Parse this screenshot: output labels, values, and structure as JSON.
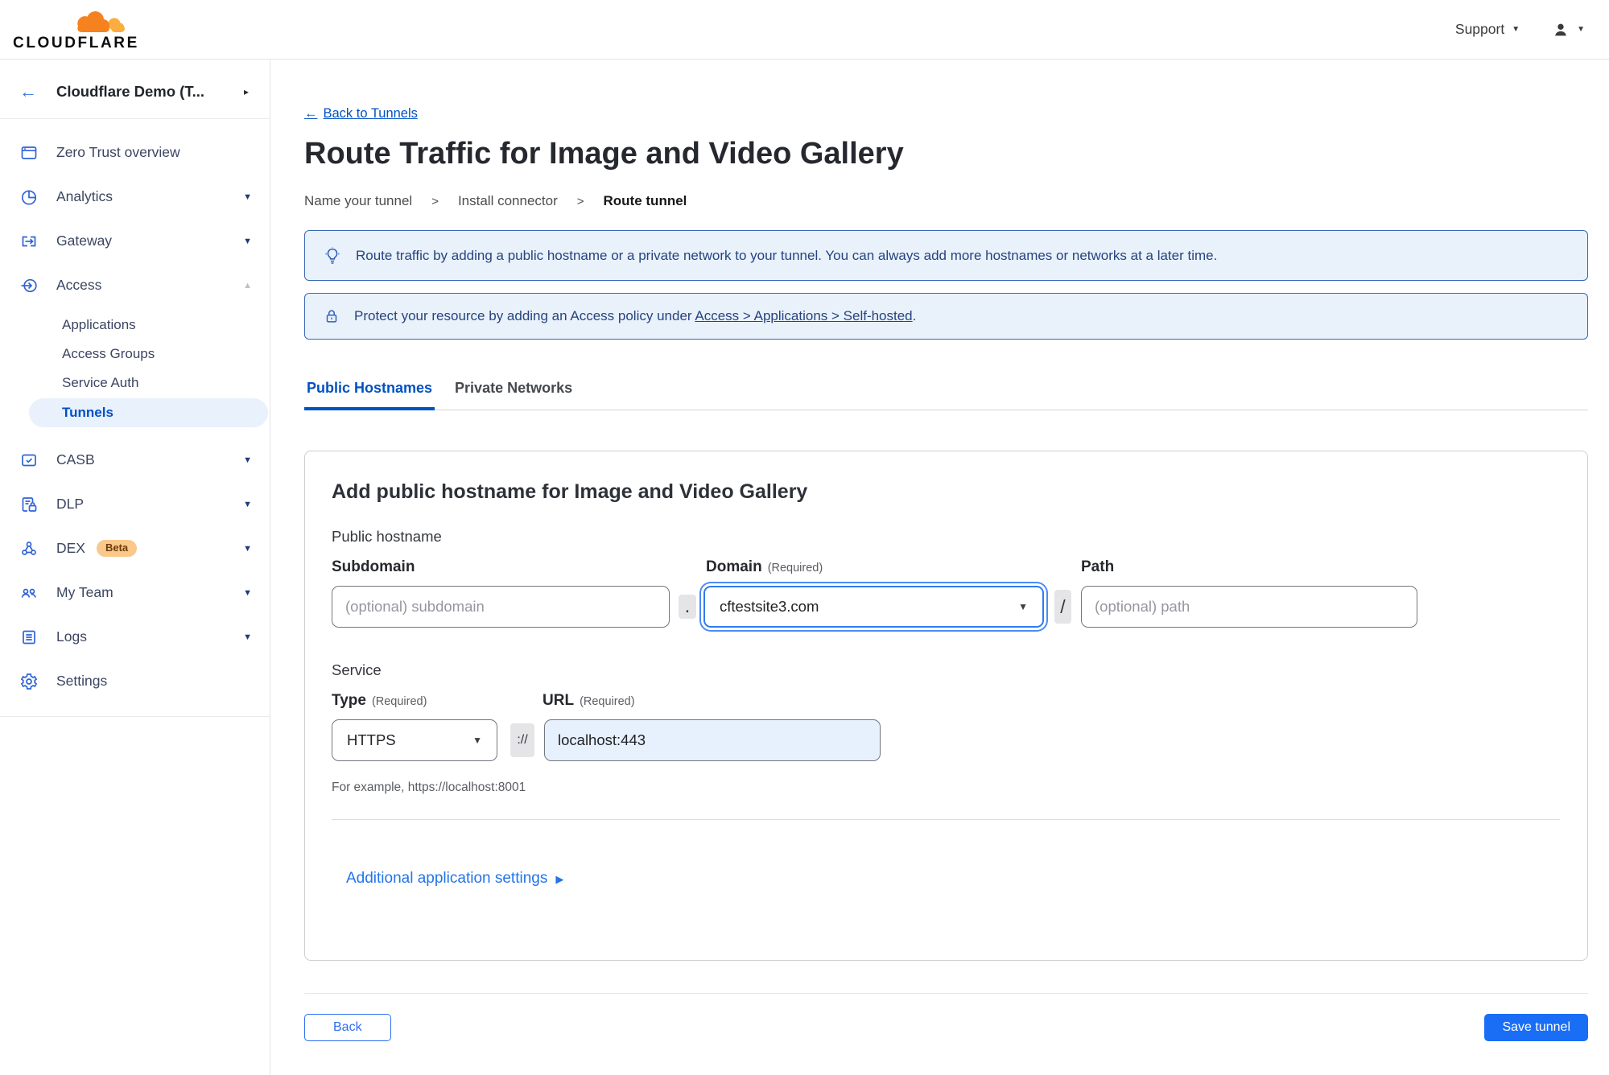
{
  "topbar": {
    "logo_text": "CLOUDFLARE",
    "support_label": "Support"
  },
  "icons": {
    "caret_down": "▼",
    "caret_up": "▲",
    "caret_right_small": "▸",
    "caret_right_play": "▶",
    "back_arrow": "←",
    "breadcrumb_separator": ">"
  },
  "colors": {
    "brand_orange": "#f6821f",
    "brand_orange_light": "#fbad41",
    "link_blue": "#0051c3",
    "button_blue": "#1a6ef5",
    "banner_bg": "#e9f1fb",
    "banner_border": "#3a67b4",
    "banner_text": "#26447e",
    "active_nav_bg": "#e8f1fc",
    "beta_badge_bg": "#f9c88a",
    "url_input_bg": "#e7f0fd",
    "focus_ring": "#4d8bf5"
  },
  "sidebar": {
    "account_name": "Cloudflare Demo (T...",
    "items": [
      {
        "label": "Zero Trust overview"
      },
      {
        "label": "Analytics"
      },
      {
        "label": "Gateway"
      },
      {
        "label": "Access"
      },
      {
        "label": "CASB"
      },
      {
        "label": "DLP"
      },
      {
        "label": "DEX",
        "badge": "Beta"
      },
      {
        "label": "My Team"
      },
      {
        "label": "Logs"
      },
      {
        "label": "Settings"
      }
    ],
    "access_subitems": [
      {
        "label": "Applications"
      },
      {
        "label": "Access Groups"
      },
      {
        "label": "Service Auth"
      },
      {
        "label": "Tunnels"
      }
    ]
  },
  "page": {
    "back_link": "Back to Tunnels",
    "title": "Route Traffic for Image and Video Gallery",
    "steps": [
      "Name your tunnel",
      "Install connector",
      "Route tunnel"
    ],
    "banner_tip": "Route traffic by adding a public hostname or a private network to your tunnel. You can always add more hostnames or networks at a later time.",
    "banner_protect_prefix": "Protect your resource by adding an Access policy under",
    "banner_protect_link": "Access > Applications > Self-hosted",
    "banner_protect_suffix": ".",
    "tabs": [
      {
        "label": "Public Hostnames"
      },
      {
        "label": "Private Networks"
      }
    ]
  },
  "form": {
    "heading": "Add public hostname for Image and Video Gallery",
    "group_public_hostname": "Public hostname",
    "labels": {
      "subdomain": "Subdomain",
      "domain": "Domain",
      "path": "Path",
      "service": "Service",
      "type": "Type",
      "url": "URL",
      "required": "(Required)"
    },
    "subdomain_placeholder": "(optional) subdomain",
    "domain_value": "cftestsite3.com",
    "path_placeholder": "(optional) path",
    "type_value": "HTTPS",
    "url_value": "localhost:443",
    "separators": {
      "dot": ".",
      "slash": "/",
      "scheme": "://"
    },
    "example": "For example, https://localhost:8001",
    "additional_settings": "Additional application settings"
  },
  "footer": {
    "back": "Back",
    "save": "Save tunnel"
  }
}
